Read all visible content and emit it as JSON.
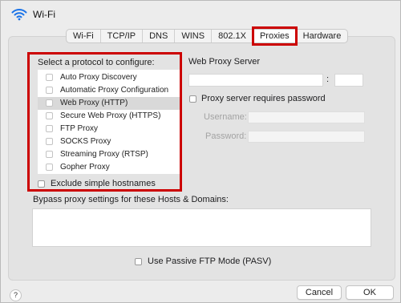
{
  "window": {
    "title": "Wi-Fi"
  },
  "tabs": [
    {
      "label": "Wi-Fi"
    },
    {
      "label": "TCP/IP"
    },
    {
      "label": "DNS"
    },
    {
      "label": "WINS"
    },
    {
      "label": "802.1X"
    },
    {
      "label": "Proxies",
      "selected": true
    },
    {
      "label": "Hardware"
    }
  ],
  "proxies": {
    "protocol_heading": "Select a protocol to configure:",
    "protocols": [
      {
        "label": "Auto Proxy Discovery",
        "checked": false
      },
      {
        "label": "Automatic Proxy Configuration",
        "checked": false
      },
      {
        "label": "Web Proxy (HTTP)",
        "checked": false,
        "selected": true
      },
      {
        "label": "Secure Web Proxy (HTTPS)",
        "checked": false
      },
      {
        "label": "FTP Proxy",
        "checked": false
      },
      {
        "label": "SOCKS Proxy",
        "checked": false
      },
      {
        "label": "Streaming Proxy (RTSP)",
        "checked": false
      },
      {
        "label": "Gopher Proxy",
        "checked": false
      }
    ],
    "exclude_simple_hostnames": "Exclude simple hostnames",
    "server_heading": "Web Proxy Server",
    "server_value": "",
    "port_separator": ":",
    "port_value": "",
    "requires_password": "Proxy server requires password",
    "username_label": "Username:",
    "password_label": "Password:",
    "bypass_label": "Bypass proxy settings for these Hosts & Domains:",
    "bypass_value": "",
    "passive_ftp": "Use Passive FTP Mode (PASV)"
  },
  "footer": {
    "help": "?",
    "cancel": "Cancel",
    "ok": "OK"
  },
  "colors": {
    "highlight": "#cc0000",
    "wifi_icon": "#1a73e8"
  }
}
